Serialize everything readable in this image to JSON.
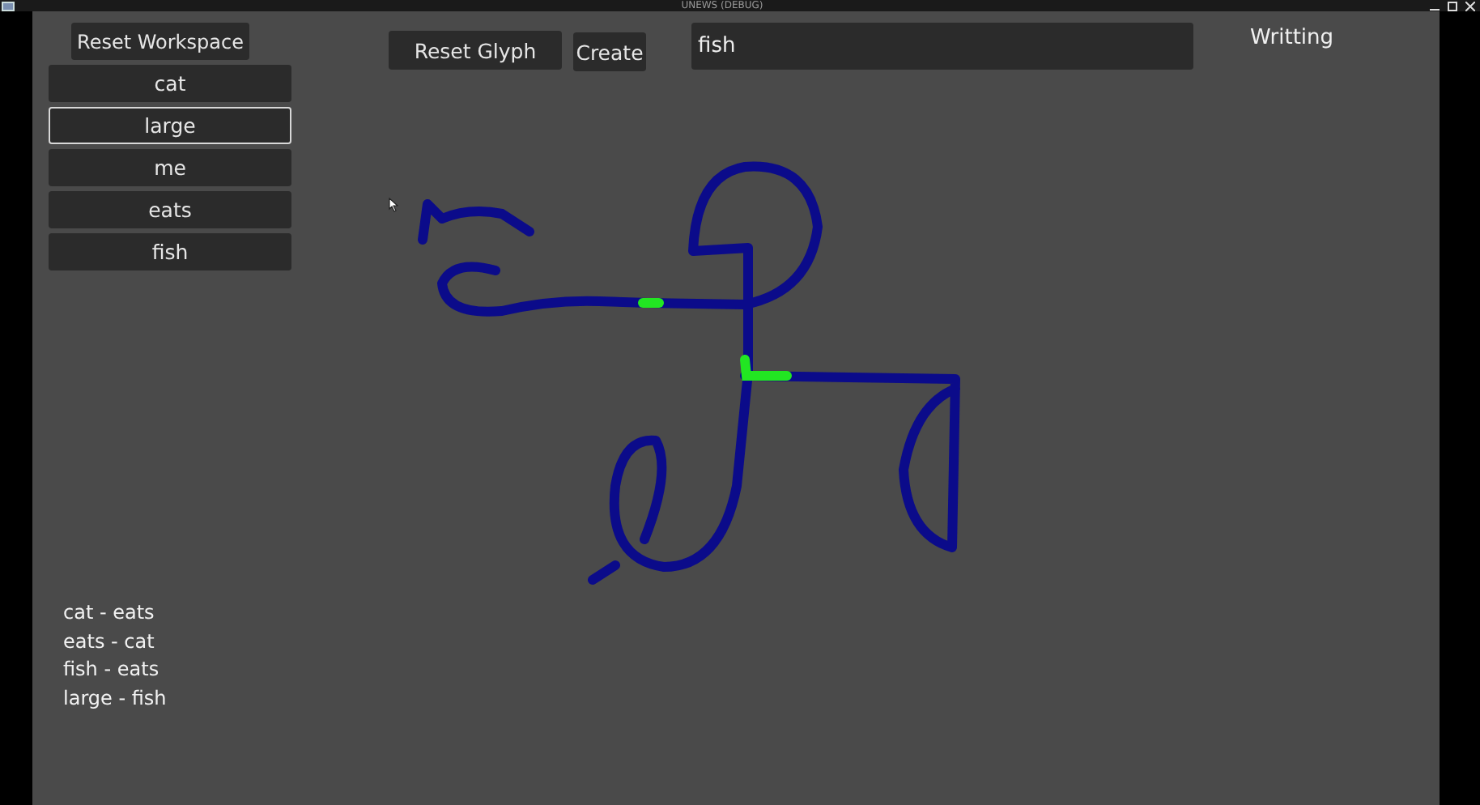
{
  "window": {
    "title": "UNEWS (DEBUG)"
  },
  "reset_workspace_button": "Reset Workspace",
  "words": [
    {
      "label": "cat",
      "selected": false
    },
    {
      "label": "large",
      "selected": true
    },
    {
      "label": "me",
      "selected": false
    },
    {
      "label": "eats",
      "selected": false
    },
    {
      "label": "fish",
      "selected": false
    }
  ],
  "toolbar": {
    "reset_glyph_button": "Reset Glyph",
    "create_button": "Create",
    "word_field": {
      "value": "fish"
    }
  },
  "mode_label": "Writting",
  "pairs": [
    "cat - eats",
    "eats - cat",
    "fish - eats",
    "large - fish"
  ]
}
